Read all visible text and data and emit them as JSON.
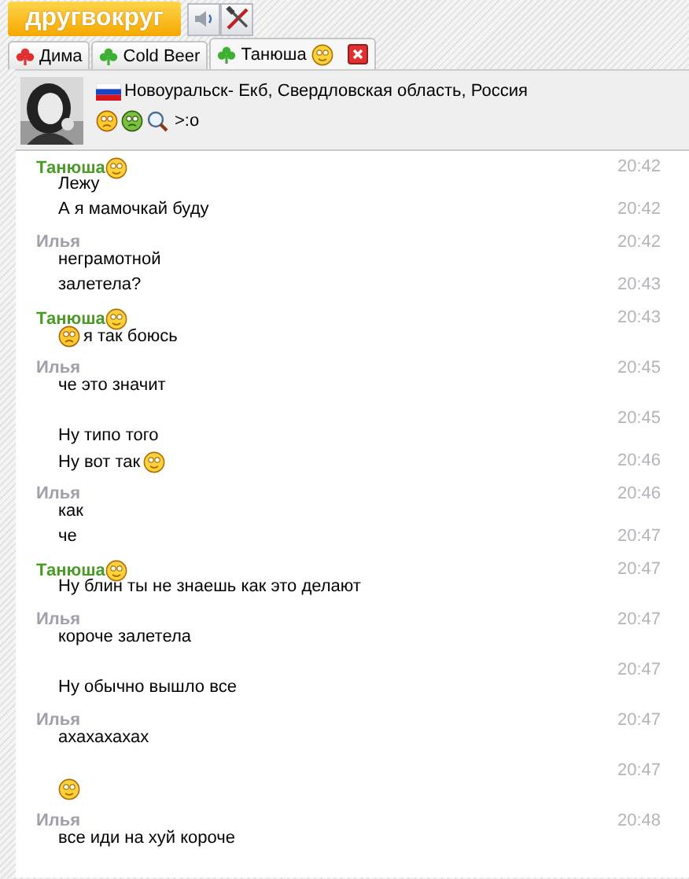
{
  "logo": "другвокруг",
  "toolbar": [
    {
      "kind": "sound"
    },
    {
      "kind": "tools"
    }
  ],
  "tabs": [
    {
      "label": "Дима",
      "online": false,
      "selected": false,
      "smiley": false,
      "closable": false
    },
    {
      "label": "Cold Beer",
      "online": true,
      "selected": false,
      "smiley": false,
      "closable": false
    },
    {
      "label": "Танюша",
      "online": true,
      "selected": true,
      "smiley": true,
      "closable": true
    }
  ],
  "profile": {
    "location": "Новоуральск- Екб, Свердловская область, Россия",
    "status_icons": [
      {
        "kind": "sad"
      },
      {
        "kind": "sick"
      },
      {
        "kind": "search"
      }
    ],
    "status_text": ">:o"
  },
  "messages": [
    {
      "author": "Танюша",
      "kind": "contact",
      "author_smiley": true,
      "entries": [
        {
          "time": "20:42",
          "parts": [
            {
              "kind": "text",
              "text": "Лежу"
            }
          ]
        },
        {
          "time": "20:42",
          "parts": [
            {
              "kind": "text",
              "text": "А я мамочкай буду"
            }
          ]
        }
      ]
    },
    {
      "author": "Илья",
      "kind": "me",
      "author_smiley": false,
      "entries": [
        {
          "time": "20:42",
          "parts": [
            {
              "kind": "text",
              "text": "неграмотной"
            }
          ]
        },
        {
          "time": "20:43",
          "parts": [
            {
              "kind": "text",
              "text": "залетела?"
            }
          ]
        }
      ]
    },
    {
      "author": "Танюша",
      "kind": "contact",
      "author_smiley": true,
      "entries": [
        {
          "time": "20:43",
          "parts": [
            {
              "kind": "sad"
            },
            {
              "kind": "text",
              "text": "я так боюсь"
            }
          ]
        }
      ]
    },
    {
      "author": "Илья",
      "kind": "me",
      "author_smiley": false,
      "entries": [
        {
          "time": "20:45",
          "parts": [
            {
              "kind": "text",
              "text": "че это значит"
            }
          ]
        }
      ]
    },
    {
      "entries": [
        {
          "time": "20:45",
          "parts": [
            {
              "kind": "text",
              "text": "Ну типо того"
            }
          ]
        },
        {
          "time": "20:46",
          "parts": [
            {
              "kind": "text",
              "text": "Ну вот так"
            },
            {
              "kind": "happy"
            }
          ]
        }
      ]
    },
    {
      "author": "Илья",
      "kind": "me",
      "author_smiley": false,
      "entries": [
        {
          "time": "20:46",
          "parts": [
            {
              "kind": "text",
              "text": "как"
            }
          ]
        },
        {
          "time": "20:47",
          "parts": [
            {
              "kind": "text",
              "text": "че"
            }
          ]
        }
      ]
    },
    {
      "author": "Танюша",
      "kind": "contact",
      "author_smiley": true,
      "entries": [
        {
          "time": "20:47",
          "parts": [
            {
              "kind": "text",
              "text": "Ну блин ты не знаешь как это делают"
            }
          ]
        }
      ]
    },
    {
      "author": "Илья",
      "kind": "me",
      "author_smiley": false,
      "entries": [
        {
          "time": "20:47",
          "parts": [
            {
              "kind": "text",
              "text": "короче залетела"
            }
          ]
        }
      ]
    },
    {
      "entries": [
        {
          "time": "20:47",
          "parts": [
            {
              "kind": "text",
              "text": "Ну обычно вышло все"
            }
          ]
        }
      ]
    },
    {
      "author": "Илья",
      "kind": "me",
      "author_smiley": false,
      "entries": [
        {
          "time": "20:47",
          "parts": [
            {
              "kind": "text",
              "text": "ахахахахах"
            }
          ]
        }
      ]
    },
    {
      "entries": [
        {
          "time": "20:47",
          "parts": [
            {
              "kind": "happy"
            }
          ]
        }
      ]
    },
    {
      "author": "Илья",
      "kind": "me",
      "author_smiley": false,
      "entries": [
        {
          "time": "20:48",
          "parts": [
            {
              "kind": "text",
              "text": "все иди на хуй короче"
            }
          ]
        }
      ]
    }
  ]
}
